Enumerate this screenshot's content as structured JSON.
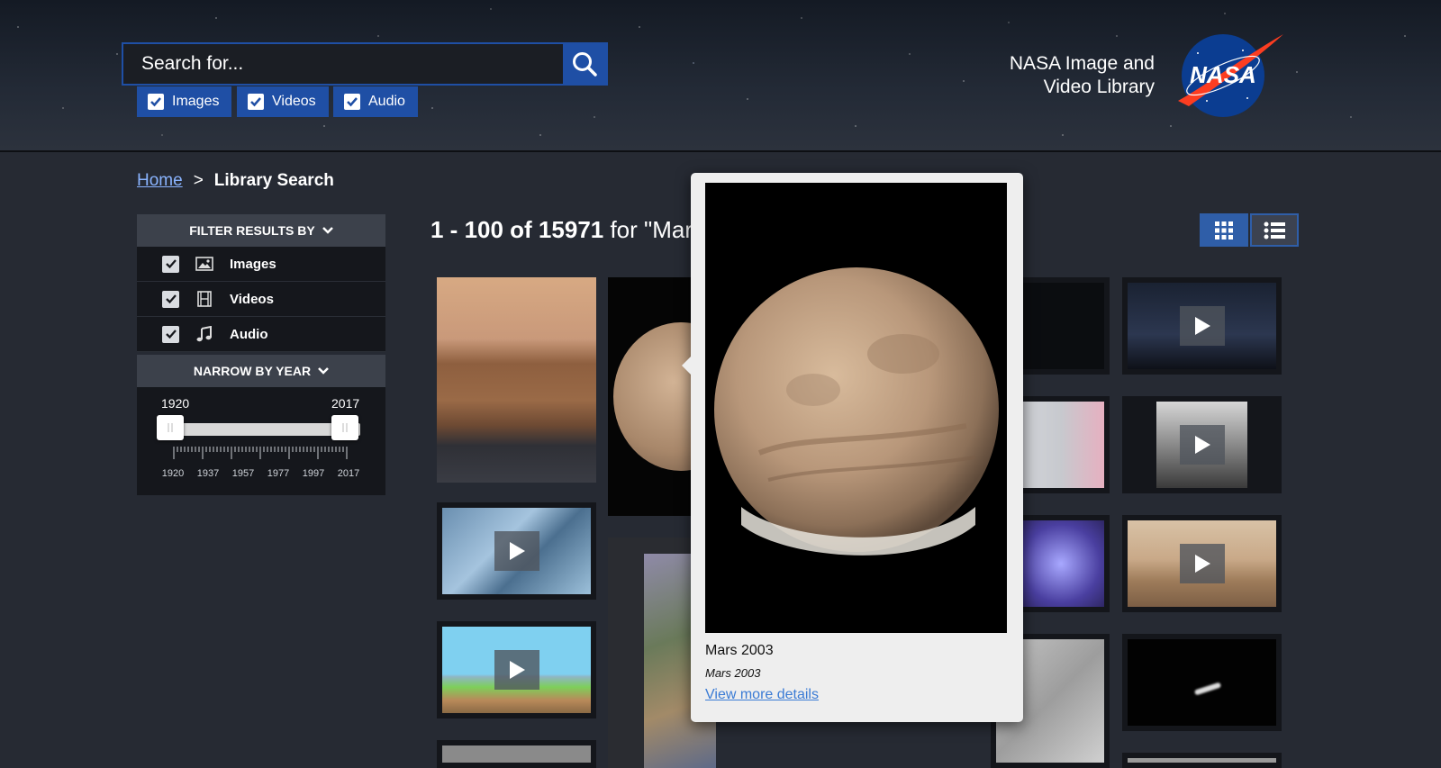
{
  "header": {
    "search_placeholder": "Search for...",
    "media_types": [
      {
        "label": "Images",
        "checked": true
      },
      {
        "label": "Videos",
        "checked": true
      },
      {
        "label": "Audio",
        "checked": true
      }
    ],
    "brand_line1": "NASA Image and",
    "brand_line2": "Video Library",
    "logo_text": "NASA"
  },
  "breadcrumb": {
    "home": "Home",
    "separator": ">",
    "current": "Library Search"
  },
  "sidebar": {
    "filter_title": "FILTER RESULTS BY",
    "filters": [
      {
        "label": "Images",
        "checked": true,
        "icon": "image-icon"
      },
      {
        "label": "Videos",
        "checked": true,
        "icon": "film-icon"
      },
      {
        "label": "Audio",
        "checked": true,
        "icon": "music-note-icon"
      }
    ],
    "year_title": "NARROW BY YEAR",
    "year_min": "1920",
    "year_max": "2017",
    "year_ticks": [
      "1920",
      "1937",
      "1957",
      "1977",
      "1997",
      "2017"
    ]
  },
  "results": {
    "range": "1 - 100 of 15971",
    "query_prefix": " for \"Mar",
    "view_modes": [
      "grid-view-icon",
      "list-view-icon"
    ],
    "active_view": "grid"
  },
  "popover": {
    "title": "Mars 2003",
    "subtitle": "Mars 2003",
    "link": "View more details"
  },
  "colors": {
    "accent": "#1f4fa5",
    "link": "#8ab4ff",
    "background": "#262a33",
    "panel": "#15171c"
  }
}
